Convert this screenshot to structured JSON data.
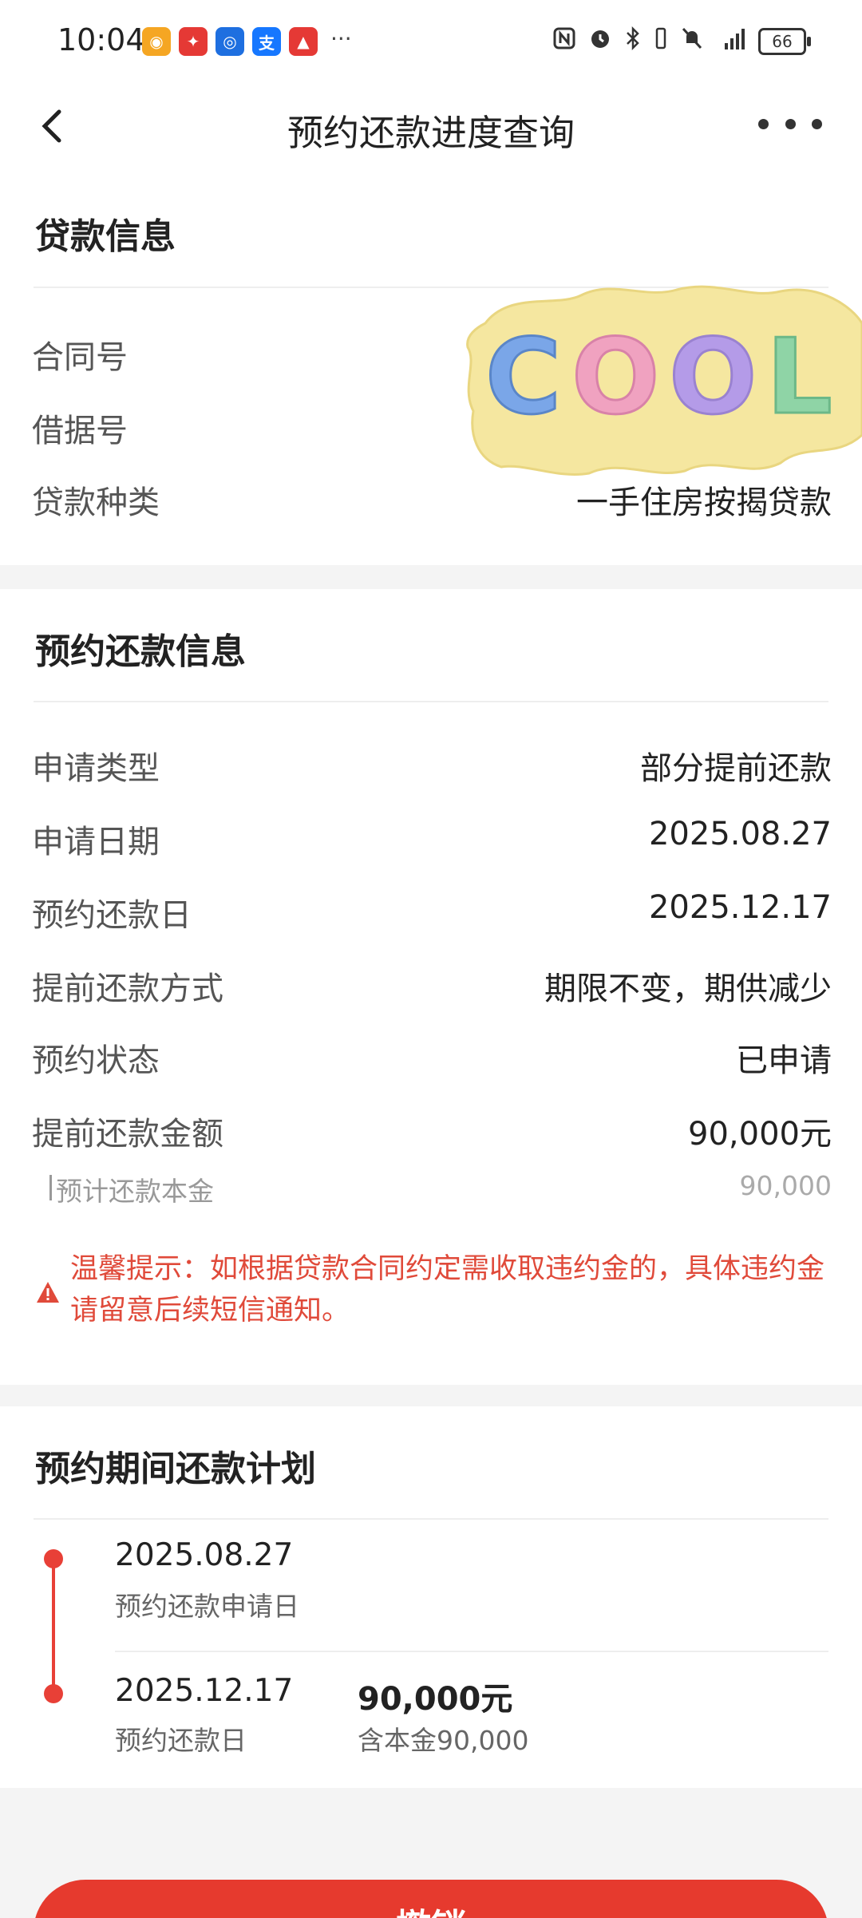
{
  "status_bar": {
    "time": "10:04",
    "notification_icons": [
      {
        "name": "weibo-icon",
        "color": "#f5a623",
        "glyph": "◉"
      },
      {
        "name": "app-red-icon",
        "color": "#e53935",
        "glyph": "✦"
      },
      {
        "name": "app-blue-icon",
        "color": "#1e6fe0",
        "glyph": "◎"
      },
      {
        "name": "alipay-icon",
        "color": "#1677ff",
        "glyph": "支"
      },
      {
        "name": "app-red2-icon",
        "color": "#e53935",
        "glyph": "▲"
      }
    ],
    "more": "···",
    "battery": "66"
  },
  "nav": {
    "title": "预约还款进度查询"
  },
  "loan_info": {
    "title": "贷款信息",
    "rows": [
      {
        "label": "合同号",
        "value": ""
      },
      {
        "label": "借据号",
        "value": ""
      },
      {
        "label": "贷款种类",
        "value": "一手住房按揭贷款"
      }
    ],
    "sticker_text": "COOL"
  },
  "repay_info": {
    "title": "预约还款信息",
    "rows": [
      {
        "label": "申请类型",
        "value": "部分提前还款"
      },
      {
        "label": "申请日期",
        "value": "2025.08.27"
      },
      {
        "label": "预约还款日",
        "value": "2025.12.17"
      },
      {
        "label": "提前还款方式",
        "value": "期限不变，期供减少"
      },
      {
        "label": "预约状态",
        "value": "已申请"
      },
      {
        "label": "提前还款金额",
        "value": "90,000元"
      }
    ],
    "sub_row": {
      "label": "预计还款本金",
      "value": "90,000"
    },
    "warning": "温馨提示：如根据贷款合同约定需收取违约金的，具体违约金请留意后续短信通知。"
  },
  "plan": {
    "title": "预约期间还款计划",
    "items": [
      {
        "date": "2025.08.27",
        "desc": "预约还款申请日",
        "amount": "",
        "amount_desc": ""
      },
      {
        "date": "2025.12.17",
        "desc": "预约还款日",
        "amount": "90,000元",
        "amount_desc": "含本金90,000"
      }
    ]
  },
  "bottom_button": {
    "label": "撤销"
  },
  "colors": {
    "accent": "#e63a2e",
    "warning": "#e04a3a",
    "timeline": "#e84037"
  }
}
